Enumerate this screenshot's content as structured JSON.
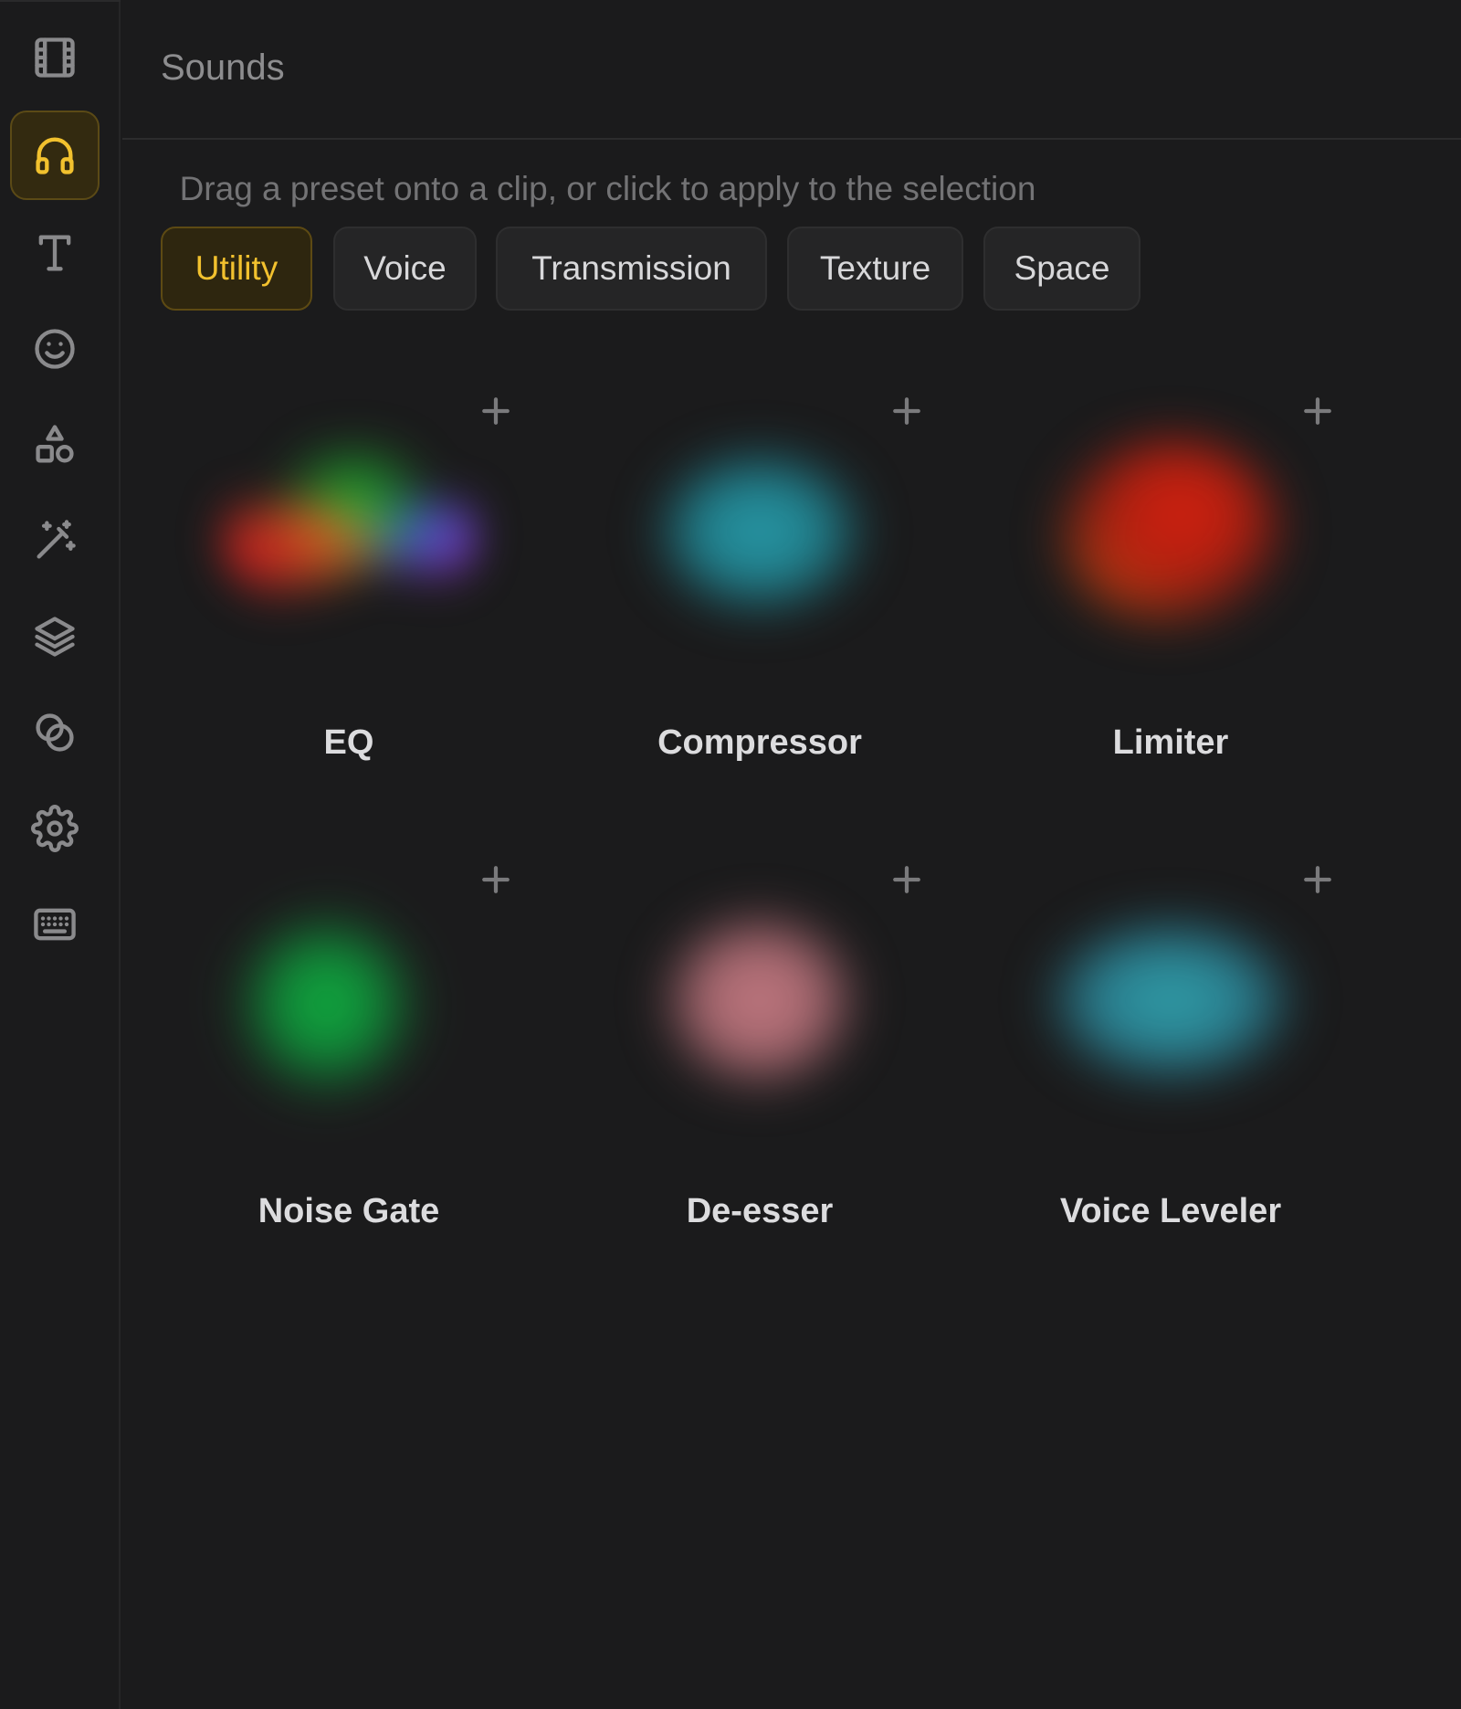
{
  "rail": {
    "items": [
      {
        "icon": "film-icon",
        "active": false
      },
      {
        "icon": "headphones-icon",
        "active": true
      },
      {
        "icon": "text-icon",
        "active": false
      },
      {
        "icon": "smiley-icon",
        "active": false
      },
      {
        "icon": "shapes-icon",
        "active": false
      },
      {
        "icon": "magic-wand-icon",
        "active": false
      },
      {
        "icon": "layers-icon",
        "active": false
      },
      {
        "icon": "overlap-circles-icon",
        "active": false
      },
      {
        "icon": "gear-icon",
        "active": false
      },
      {
        "icon": "keyboard-icon",
        "active": false
      }
    ]
  },
  "header": {
    "title": "Sounds"
  },
  "hint": "Drag a preset onto a clip, or click to apply to the selection",
  "tabs": [
    {
      "label": "Utility",
      "active": true
    },
    {
      "label": "Voice",
      "active": false
    },
    {
      "label": "Transmission",
      "active": false
    },
    {
      "label": "Texture",
      "active": false
    },
    {
      "label": "Space",
      "active": false
    }
  ],
  "presets": [
    {
      "name": "EQ",
      "add_icon": "plus-icon"
    },
    {
      "name": "Compressor",
      "add_icon": "plus-icon"
    },
    {
      "name": "Limiter",
      "add_icon": "plus-icon"
    },
    {
      "name": "Noise Gate",
      "add_icon": "plus-icon"
    },
    {
      "name": "De-esser",
      "add_icon": "plus-icon"
    },
    {
      "name": "Voice Leveler",
      "add_icon": "plus-icon"
    }
  ],
  "colors": {
    "accent": "#f2c12e",
    "background": "#1b1b1c",
    "eq_gradient": [
      "#d42020",
      "#e0a020",
      "#20b030",
      "#3060d0",
      "#a030d0"
    ],
    "compressor": "#2a9aa8",
    "limiter": "#d02010",
    "noise_gate": "#10b040",
    "de_esser": "#c07880",
    "voice_leveler": "#30a0a8"
  }
}
